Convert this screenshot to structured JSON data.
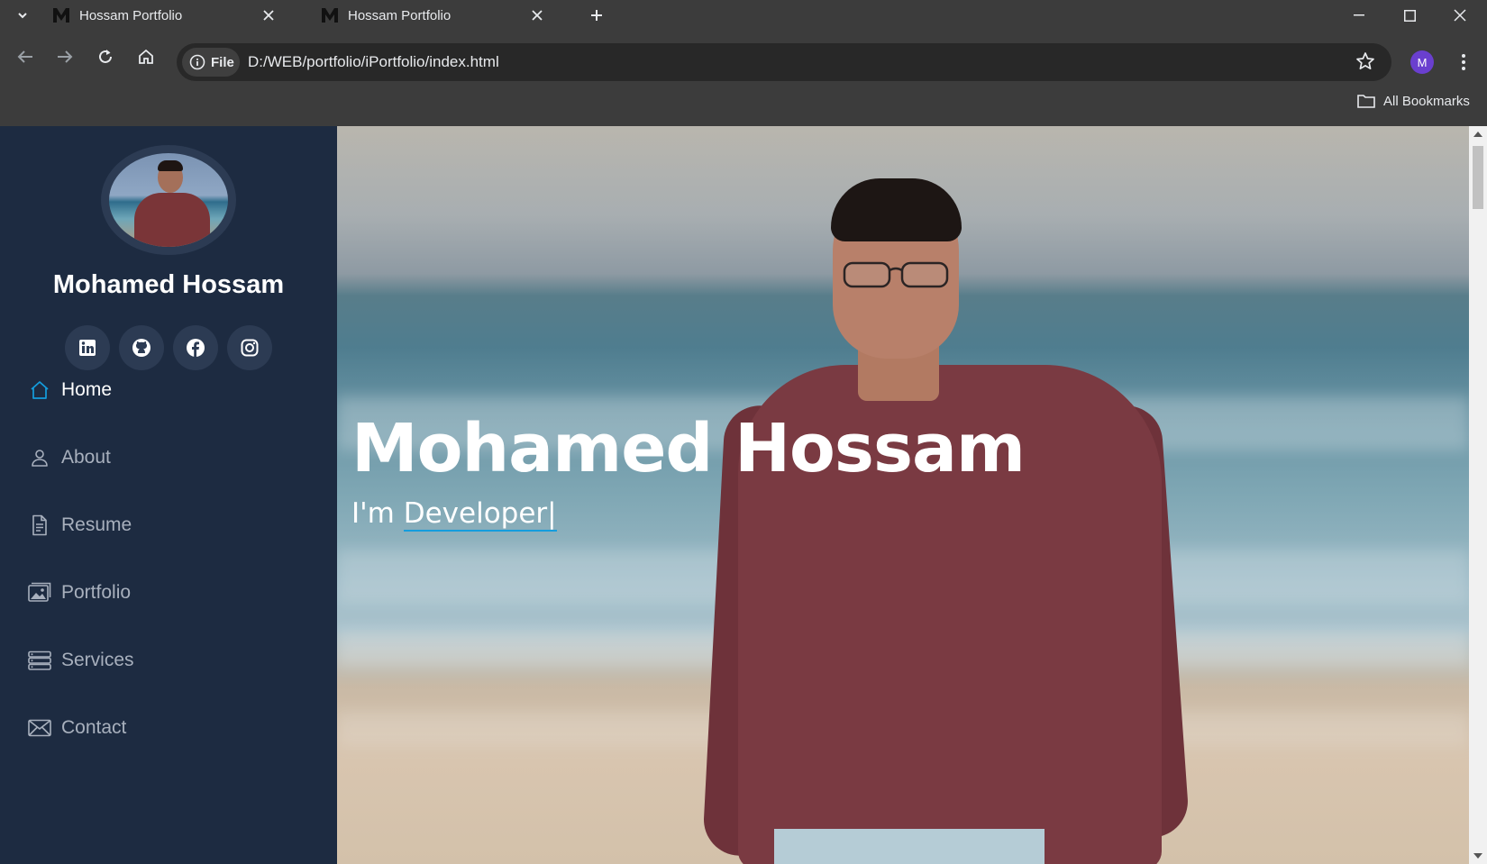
{
  "browser": {
    "tabs": [
      {
        "title": "Hossam Portfolio",
        "favicon": "M-logo-icon"
      },
      {
        "title": "Hossam Portfolio",
        "favicon": "M-logo-icon"
      }
    ],
    "address": {
      "chip_label": "File",
      "url": "D:/WEB/portfolio/iPortfolio/index.html"
    },
    "profile_initial": "M",
    "bookmarks_label": "All Bookmarks"
  },
  "sidebar": {
    "name": "Mohamed Hossam",
    "socials": [
      "linkedin-icon",
      "github-icon",
      "facebook-icon",
      "instagram-icon"
    ],
    "nav": [
      {
        "label": "Home",
        "icon": "home-icon",
        "active": true
      },
      {
        "label": "About",
        "icon": "person-icon",
        "active": false
      },
      {
        "label": "Resume",
        "icon": "document-icon",
        "active": false
      },
      {
        "label": "Portfolio",
        "icon": "images-icon",
        "active": false
      },
      {
        "label": "Services",
        "icon": "server-icon",
        "active": false
      },
      {
        "label": "Contact",
        "icon": "envelope-icon",
        "active": false
      }
    ]
  },
  "hero": {
    "title": "Mohamed Hossam",
    "prefix": "I'm ",
    "typed": "Developer",
    "cursor": "|"
  },
  "colors": {
    "sidebar_bg": "#1d2b41",
    "accent": "#149ddd",
    "chrome_bg": "#3c3c3c"
  }
}
